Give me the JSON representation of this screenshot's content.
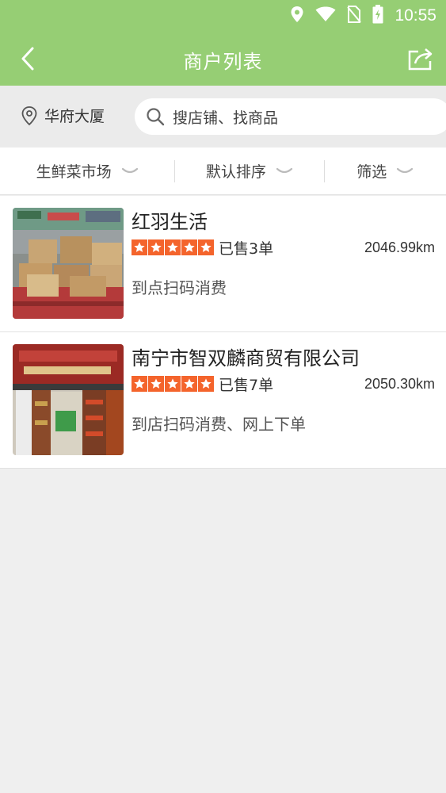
{
  "status": {
    "time": "10:55"
  },
  "header": {
    "title": "商户列表"
  },
  "search": {
    "location": "华府大厦",
    "placeholder": "搜店铺、找商品"
  },
  "filters": [
    {
      "label": "生鲜菜市场"
    },
    {
      "label": "默认排序"
    },
    {
      "label": "筛选"
    }
  ],
  "merchants": [
    {
      "name": "红羽生活",
      "rating": 5,
      "sold": "已售3单",
      "distance": "2046.99km",
      "services": "到点扫码消费"
    },
    {
      "name": "南宁市智双麟商贸有限公司",
      "rating": 5,
      "sold": "已售7单",
      "distance": "2050.30km",
      "services": "到店扫码消费、网上下单"
    }
  ],
  "colors": {
    "brand": "#96ce74",
    "star": "#f4642c"
  }
}
